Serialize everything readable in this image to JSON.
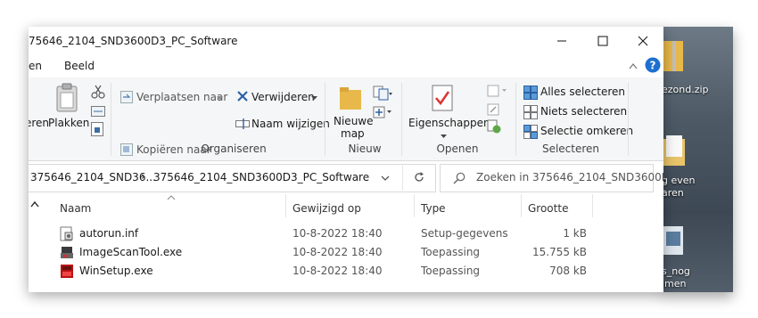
{
  "window": {
    "title": "375646_2104_SND3600D3_PC_Software",
    "visible_title": "75646_2104_SND3600D3_PC_Software"
  },
  "tabs": {
    "left_partial": "en",
    "view": "Beeld"
  },
  "ribbon": {
    "clipboard": {
      "cut_partial": "eren",
      "paste": "Plakken"
    },
    "organize": {
      "move_to": "Verplaatsen naar",
      "copy_to": "Kopiëren naar",
      "delete": "Verwijderen",
      "rename": "Naam wijzigen",
      "group_label": "Organiseren"
    },
    "new": {
      "new_folder_line1": "Nieuwe",
      "new_folder_line2": "map",
      "group_label": "Nieuw"
    },
    "open": {
      "properties": "Eigenschappen",
      "group_label": "Openen"
    },
    "select": {
      "select_all": "Alles selecteren",
      "select_none": "Niets selecteren",
      "invert": "Selectie omkeren",
      "group_label": "Selecteren"
    }
  },
  "address": {
    "crumb_1": "375646_2104_SND36...",
    "crumb_sep": "›",
    "crumb_2": "375646_2104_SND3600D3_PC_Software"
  },
  "search": {
    "placeholder": "Zoeken in 375646_2104_SND3600D3..."
  },
  "columns": {
    "name": "Naam",
    "modified": "Gewijzigd op",
    "type": "Type",
    "size": "Grootte"
  },
  "files": [
    {
      "name": "autorun.inf",
      "modified": "10-8-2022 18:40",
      "type": "Setup-gegevens",
      "size": "1 kB",
      "icon": "inf-file-icon"
    },
    {
      "name": "ImageScanTool.exe",
      "modified": "10-8-2022 18:40",
      "type": "Toepassing",
      "size": "15.755 kB",
      "icon": "scanner-app-icon"
    },
    {
      "name": "WinSetup.exe",
      "modified": "10-8-2022 18:40",
      "type": "Toepassing",
      "size": "708 kB",
      "icon": "setup-app-icon"
    }
  ],
  "desktop": {
    "item_1": "ezond.zip",
    "item_2_line1": "g even",
    "item_2_line2": "aren",
    "item_3_line1": "s_nog",
    "item_3_line2": "imen"
  },
  "colors": {
    "accent": "#1a73c9",
    "ribbon_bg": "#f5f6f7",
    "help": "#1e6fd0"
  }
}
